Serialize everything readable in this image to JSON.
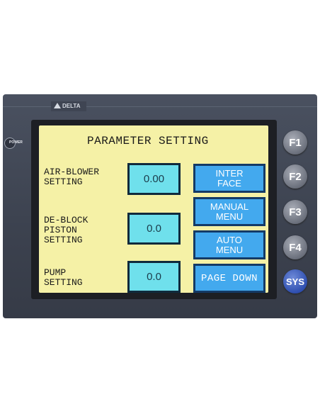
{
  "device": {
    "brand": "DELTA",
    "power_label": "POWER"
  },
  "screen": {
    "title": "PARAMETER SETTING",
    "params": [
      {
        "label": [
          "AIR-BLOWER",
          "SETTING"
        ],
        "value": "0.00"
      },
      {
        "label": [
          "DE-BLOCK",
          "PISTON",
          "SETTING"
        ],
        "value": "0.0"
      },
      {
        "label": [
          "PUMP",
          "SETTING"
        ],
        "value": "0.0"
      }
    ],
    "buttons": [
      {
        "label": [
          "INTER",
          "FACE"
        ]
      },
      {
        "label": [
          "MANUAL",
          "MENU"
        ]
      },
      {
        "label": [
          "AUTO",
          "MENU"
        ]
      },
      {
        "label": [
          "PAGE DOWN"
        ]
      }
    ]
  },
  "function_keys": [
    "F1",
    "F2",
    "F3",
    "F4",
    "SYS"
  ],
  "colors": {
    "screen_bg": "#f5f1a6",
    "value_box": "#6fe0ec",
    "button": "#43a9ee",
    "bezel": "#3c424f",
    "sys_key": "#2f4fb0"
  }
}
